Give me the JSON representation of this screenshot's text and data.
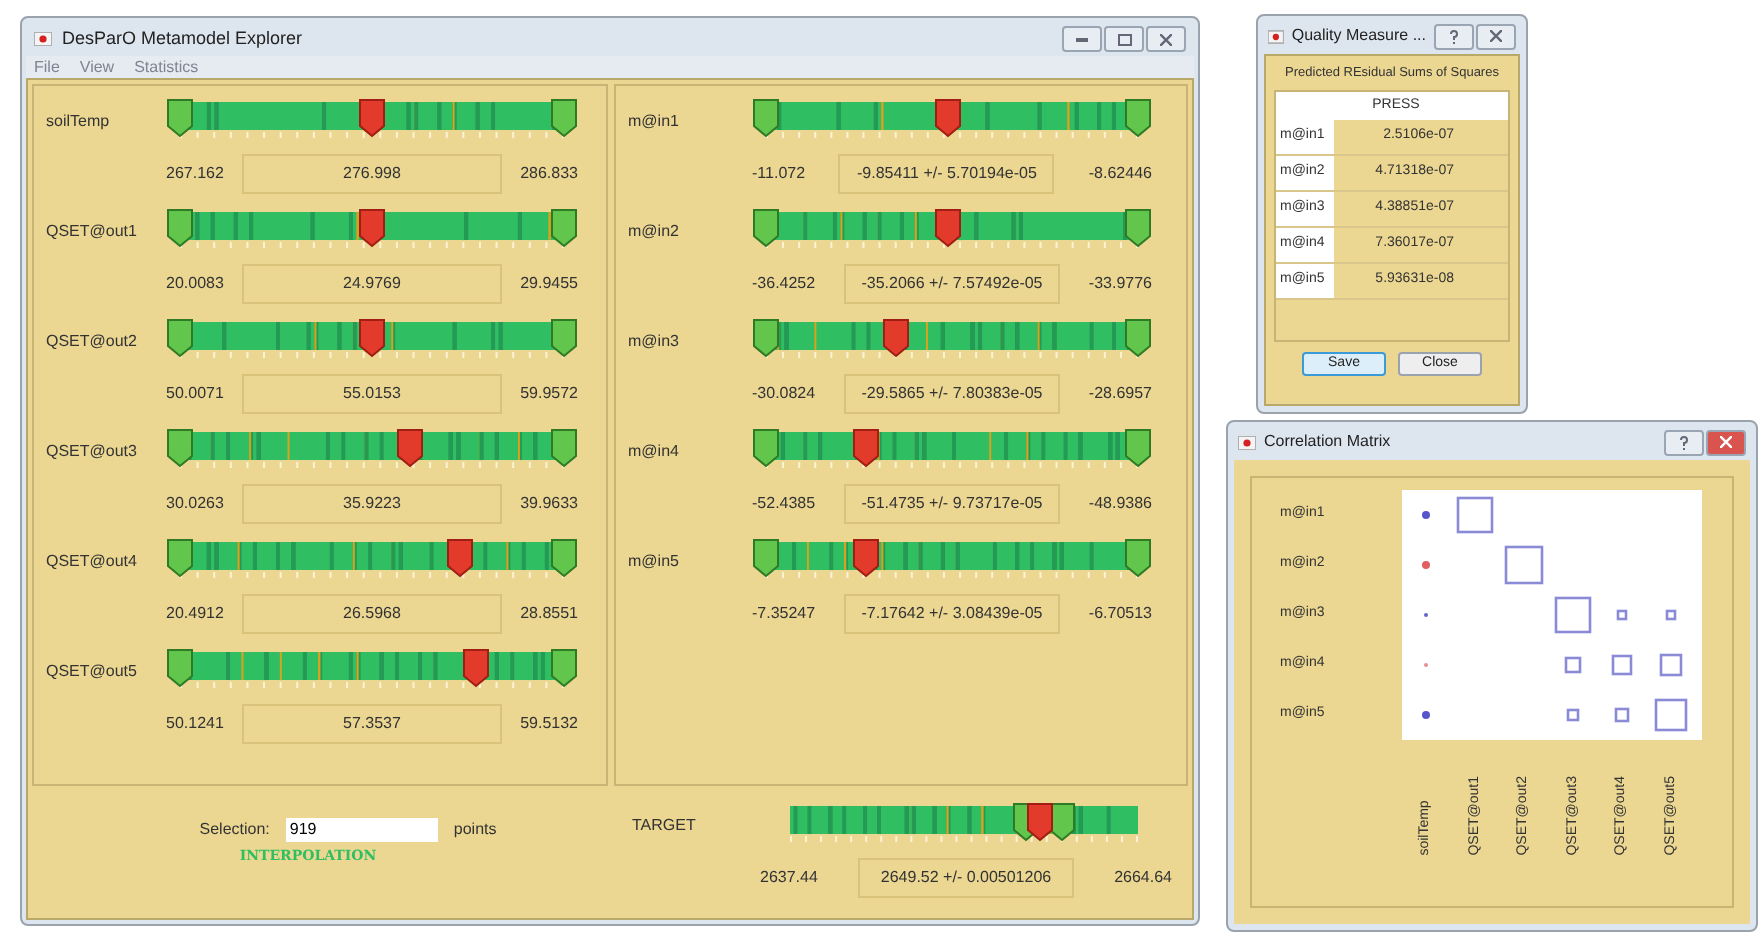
{
  "main_window": {
    "title": "DesParO Metamodel Explorer",
    "menu": [
      {
        "label": "File",
        "disabled": true
      },
      {
        "label": "View",
        "disabled": true
      },
      {
        "label": "Statistics",
        "disabled": true
      }
    ],
    "left_sliders": [
      {
        "label": "soilTemp",
        "min": "267.162",
        "value": "276.998",
        "max": "286.833",
        "level": 0.5,
        "bounds": [
          {
            "level": 0
          },
          {
            "level": 1
          }
        ]
      },
      {
        "label": "QSET@out1",
        "min": "20.0083",
        "value": "24.9769",
        "max": "29.9455",
        "level": 0.5,
        "bounds": [
          {
            "level": 0
          },
          {
            "level": 1
          }
        ]
      },
      {
        "label": "QSET@out2",
        "min": "50.0071",
        "value": "55.0153",
        "max": "59.9572",
        "level": 0.5,
        "bounds": [
          {
            "level": 0
          },
          {
            "level": 1
          }
        ]
      },
      {
        "label": "QSET@out3",
        "min": "30.0263",
        "value": "35.9223",
        "max": "39.9633",
        "level": 0.6,
        "bounds": [
          {
            "level": 0
          },
          {
            "level": 1
          }
        ]
      },
      {
        "label": "QSET@out4",
        "min": "20.4912",
        "value": "26.5968",
        "max": "28.8551",
        "level": 0.73,
        "bounds": [
          {
            "level": 0
          },
          {
            "level": 1
          }
        ]
      },
      {
        "label": "QSET@out5",
        "min": "50.1241",
        "value": "57.3537",
        "max": "59.5132",
        "level": 0.77,
        "bounds": [
          {
            "level": 0
          },
          {
            "level": 1
          }
        ]
      }
    ],
    "right_sliders": [
      {
        "label": "m@in1",
        "min": "-11.072",
        "value": "-9.85411 +/- 5.70194e-05",
        "max": "-8.62446",
        "level": 0.49,
        "bounds": [
          {
            "level": 0
          },
          {
            "level": 1
          }
        ]
      },
      {
        "label": "m@in2",
        "min": "-36.4252",
        "value": "-35.2066 +/- 7.57492e-05",
        "max": "-33.9776",
        "level": 0.49,
        "bounds": [
          {
            "level": 0
          },
          {
            "level": 1
          }
        ]
      },
      {
        "label": "m@in3",
        "min": "-30.0824",
        "value": "-29.5865 +/- 7.80383e-05",
        "max": "-28.6957",
        "level": 0.35,
        "bounds": [
          {
            "level": 0
          },
          {
            "level": 1
          }
        ]
      },
      {
        "label": "m@in4",
        "min": "-52.4385",
        "value": "-51.4735 +/- 9.73717e-05",
        "max": "-48.9386",
        "level": 0.27,
        "bounds": [
          {
            "level": 0
          },
          {
            "level": 1
          }
        ]
      },
      {
        "label": "m@in5",
        "min": "-7.35247",
        "value": "-7.17642 +/- 3.08439e-05",
        "max": "-6.70513",
        "level": 0.27,
        "bounds": [
          {
            "level": 0
          },
          {
            "level": 1
          }
        ]
      }
    ],
    "selection": {
      "label": "Selection:",
      "value": "919",
      "unit": "points"
    },
    "mode": "INTERPOLATION",
    "target": {
      "label": "TARGET",
      "min": "2637.44",
      "value": "2649.52 +/- 0.00501206",
      "max": "2664.64",
      "level": 0.72,
      "bounds": [
        {
          "level": 0.68
        },
        {
          "level": 0.78
        }
      ]
    }
  },
  "quality_window": {
    "title": "Quality Measure ...",
    "caption": "Predicted REsidual Sums of Squares",
    "column": "PRESS",
    "rows": [
      {
        "name": "m@in1",
        "value": "2.5106e-07"
      },
      {
        "name": "m@in2",
        "value": "4.71318e-07"
      },
      {
        "name": "m@in3",
        "value": "4.38851e-07"
      },
      {
        "name": "m@in4",
        "value": "7.36017e-07"
      },
      {
        "name": "m@in5",
        "value": "5.93631e-08"
      }
    ],
    "buttons": [
      {
        "label": "Save",
        "focused": true
      },
      {
        "label": "Close",
        "focused": false
      }
    ]
  },
  "correlation_window": {
    "title": "Correlation Matrix",
    "rows": [
      "m@in1",
      "m@in2",
      "m@in3",
      "m@in4",
      "m@in5"
    ],
    "columns": [
      "soilTemp",
      "QSET@out1",
      "QSET@out2",
      "QSET@out3",
      "QSET@out4",
      "QSET@out5"
    ]
  }
}
